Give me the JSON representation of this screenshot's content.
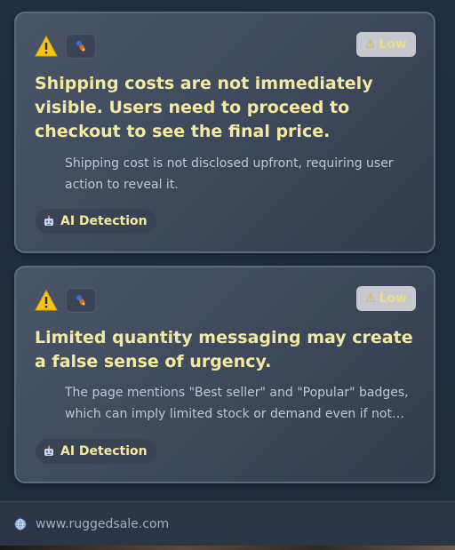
{
  "cards": [
    {
      "severity": "Low",
      "title": "Shipping costs are not immediately visible. Users need to proceed to checkout to see the final price.",
      "description": "Shipping cost is not disclosed upfront, requiring user action to reveal it.",
      "source": "AI Detection"
    },
    {
      "severity": "Low",
      "title": "Limited quantity messaging may create a false sense of urgency.",
      "description": "The page mentions \"Best seller\" and \"Popular\" badges, which can imply limited stock or demand even if not…",
      "source": "AI Detection"
    }
  ],
  "footer": {
    "site_url": "www.ruggedsale.com"
  },
  "icons": {
    "warning": "warning-triangle-icon",
    "tool": "inspector-tool-icon",
    "robot": "robot-icon",
    "globe": "globe-icon"
  },
  "colors": {
    "title_accent": "#f3e9a0",
    "warning_yellow": "#f5c518",
    "card_border": "#5b6a80",
    "severity_badge_bg": "#c7c9cf"
  }
}
